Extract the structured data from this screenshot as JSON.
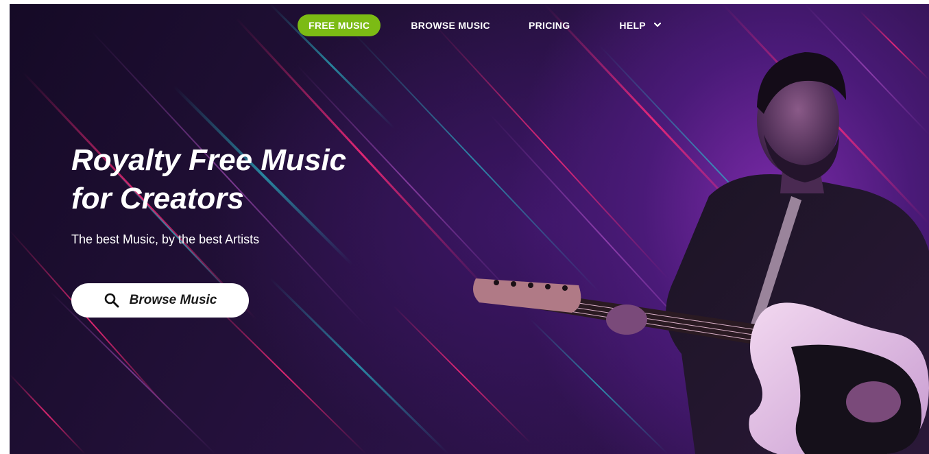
{
  "nav": {
    "items": [
      {
        "label": "FREE MUSIC",
        "active": true
      },
      {
        "label": "BROWSE MUSIC",
        "active": false
      },
      {
        "label": "PRICING",
        "active": false
      },
      {
        "label": "HELP",
        "active": false,
        "dropdown": true
      }
    ],
    "dropdown_icon": "chevron-down-icon"
  },
  "hero": {
    "title_line1": "Royalty Free Music",
    "title_line2": "for Creators",
    "subtitle": "The best Music, by the best Artists",
    "button_label": "Browse Music",
    "button_icon": "search-icon"
  },
  "colors": {
    "accent": "#7cbb14",
    "background_dark": "#1e0d33",
    "background_purple": "#5a1f8c",
    "streak_pink": "#e0206a",
    "streak_teal": "#2aa6b8"
  }
}
